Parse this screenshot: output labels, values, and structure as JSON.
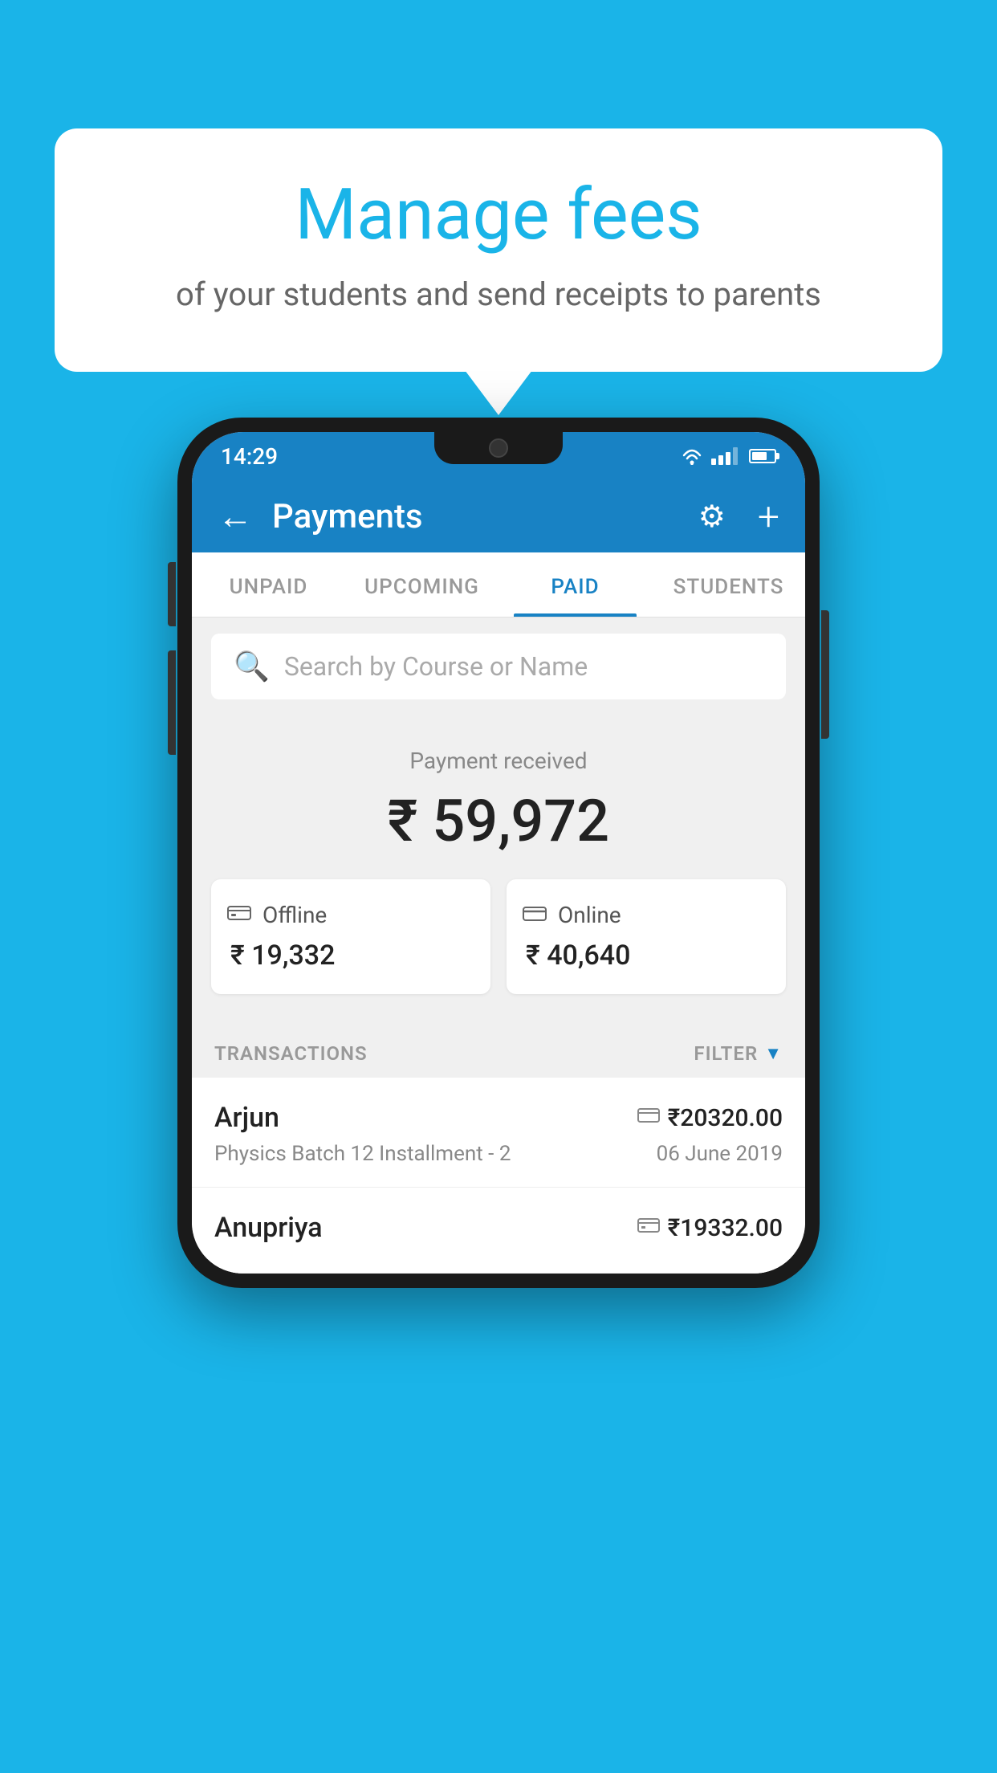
{
  "page": {
    "background_color": "#1ab4e8"
  },
  "speech_bubble": {
    "title": "Manage fees",
    "subtitle": "of your students and send receipts to parents"
  },
  "phone": {
    "status_bar": {
      "time": "14:29"
    },
    "header": {
      "title": "Payments",
      "back_label": "←",
      "gear_label": "⚙",
      "plus_label": "+"
    },
    "tabs": [
      {
        "label": "UNPAID",
        "active": false
      },
      {
        "label": "UPCOMING",
        "active": false
      },
      {
        "label": "PAID",
        "active": true
      },
      {
        "label": "STUDENTS",
        "active": false
      }
    ],
    "search": {
      "placeholder": "Search by Course or Name"
    },
    "payment_summary": {
      "label": "Payment received",
      "amount": "₹ 59,972",
      "offline_label": "Offline",
      "offline_amount": "₹ 19,332",
      "online_label": "Online",
      "online_amount": "₹ 40,640"
    },
    "transactions_section": {
      "label": "TRANSACTIONS",
      "filter_label": "FILTER"
    },
    "transactions": [
      {
        "name": "Arjun",
        "course": "Physics Batch 12 Installment - 2",
        "amount": "₹20320.00",
        "date": "06 June 2019",
        "payment_type": "card"
      },
      {
        "name": "Anupriya",
        "course": "",
        "amount": "₹19332.00",
        "date": "",
        "payment_type": "cash"
      }
    ]
  }
}
